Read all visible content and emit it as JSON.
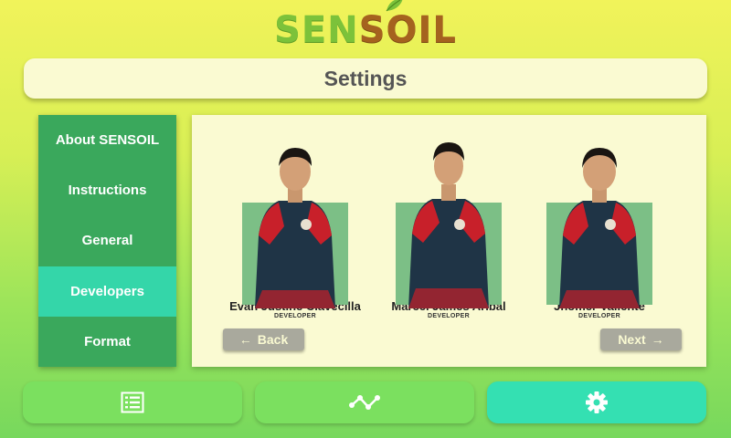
{
  "logo": {
    "part1": "SEN",
    "part2": "SO",
    "part3": "IL"
  },
  "title": "Settings",
  "sidebar": {
    "items": [
      {
        "label": "About SENSOIL"
      },
      {
        "label": "Instructions"
      },
      {
        "label": "General"
      },
      {
        "label": "Developers"
      },
      {
        "label": "Format"
      }
    ],
    "active": "Developers"
  },
  "developers": [
    {
      "name": "Evan Justine Clavecilla",
      "role": "DEVELOPER"
    },
    {
      "name": "Marcel James Aribal",
      "role": "DEVELOPER"
    },
    {
      "name": "Jhomer Valiente",
      "role": "DEVELOPER"
    }
  ],
  "nav": {
    "back_label": "Back",
    "next_label": "Next"
  },
  "bottom_nav": [
    {
      "icon": "list-icon"
    },
    {
      "icon": "line-chart-icon"
    },
    {
      "icon": "gear-icon"
    }
  ],
  "colors": {
    "sidebar": "#3aa85c",
    "sidebar_active": "#34d6a9",
    "panel": "#fafad2",
    "bottom_button": "#7be05f",
    "bottom_button_active": "#34e0b2"
  }
}
